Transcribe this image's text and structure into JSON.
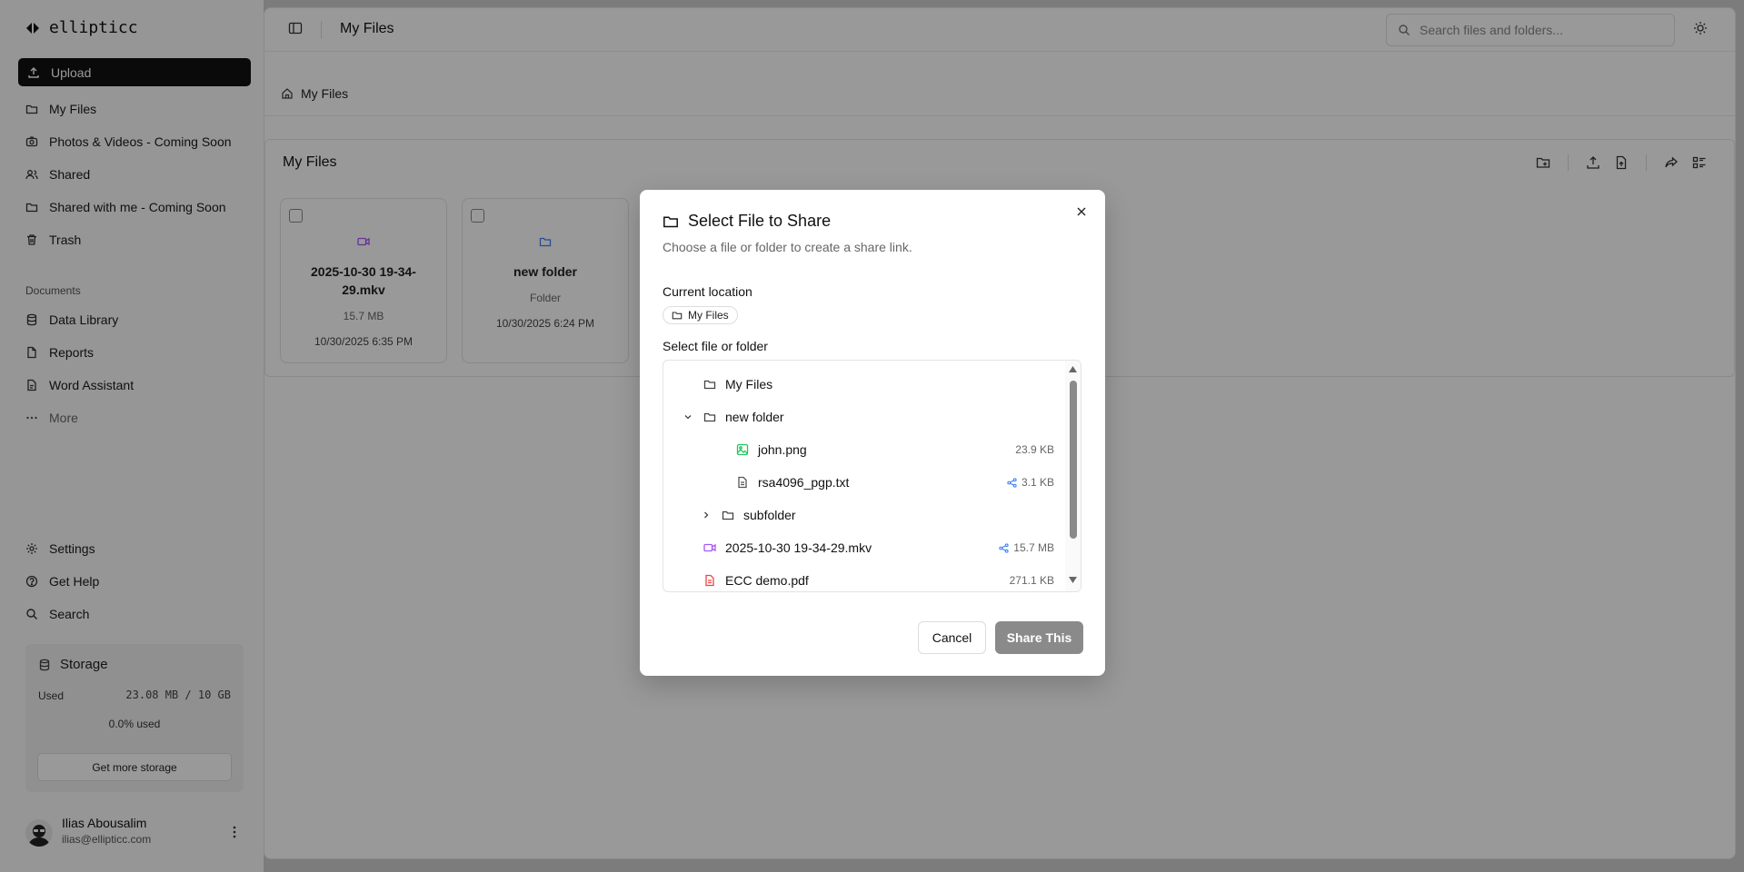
{
  "brand": {
    "name": "ellipticc"
  },
  "sidebar": {
    "upload_label": "Upload",
    "items": [
      {
        "label": "My Files"
      },
      {
        "label": "Photos & Videos - Coming Soon"
      },
      {
        "label": "Shared"
      },
      {
        "label": "Shared with me - Coming Soon"
      },
      {
        "label": "Trash"
      }
    ],
    "documents_section": "Documents",
    "doc_items": [
      {
        "label": "Data Library"
      },
      {
        "label": "Reports"
      },
      {
        "label": "Word Assistant"
      },
      {
        "label": "More"
      }
    ],
    "bottom_items": [
      {
        "label": "Settings"
      },
      {
        "label": "Get Help"
      },
      {
        "label": "Search"
      }
    ],
    "storage": {
      "title": "Storage",
      "used_label": "Used",
      "used_value": "23.08 MB / 10 GB",
      "percent_text": "0.0% used",
      "button_label": "Get more storage"
    },
    "user": {
      "name": "Ilias Abousalim",
      "email": "ilias@ellipticc.com"
    }
  },
  "header": {
    "title": "My Files",
    "search_placeholder": "Search files and folders..."
  },
  "breadcrumb": {
    "label": "My Files"
  },
  "files_panel": {
    "title": "My Files",
    "cards": [
      {
        "name": "2025-10-30 19-34-29.mkv",
        "meta": "15.7 MB",
        "date": "10/30/2025 6:35 PM",
        "icon": "video-icon"
      },
      {
        "name": "new folder",
        "meta": "Folder",
        "date": "10/30/2025 6:24 PM",
        "icon": "folder-icon"
      }
    ]
  },
  "dialog": {
    "title": "Select File to Share",
    "subtitle": "Choose a file or folder to create a share link.",
    "current_location_label": "Current location",
    "current_location_value": "My Files",
    "select_label": "Select file or folder",
    "tree": [
      {
        "name": "My Files",
        "size": "",
        "icon": "folder-icon",
        "shared": false
      },
      {
        "name": "new folder",
        "size": "",
        "icon": "folder-icon",
        "shared": false,
        "expanded": true
      },
      {
        "name": "john.png",
        "size": "23.9 KB",
        "icon": "image-icon",
        "shared": false
      },
      {
        "name": "rsa4096_pgp.txt",
        "size": "3.1 KB",
        "icon": "text-file-icon",
        "shared": true
      },
      {
        "name": "subfolder",
        "size": "",
        "icon": "folder-icon",
        "shared": false,
        "expanded": false
      },
      {
        "name": "2025-10-30 19-34-29.mkv",
        "size": "15.7 MB",
        "icon": "video-icon",
        "shared": true
      },
      {
        "name": "ECC demo.pdf",
        "size": "271.1 KB",
        "icon": "pdf-icon",
        "shared": false
      }
    ],
    "cancel_label": "Cancel",
    "share_label": "Share This"
  },
  "colors": {
    "primary": "#111111",
    "video_icon": "#a855f7",
    "folder_icon_card": "#3b82f6",
    "image_icon": "#22c55e",
    "pdf_icon": "#ef4444",
    "share_indicator": "#3b82f6",
    "share_button_disabled": "#8a8a8a"
  }
}
